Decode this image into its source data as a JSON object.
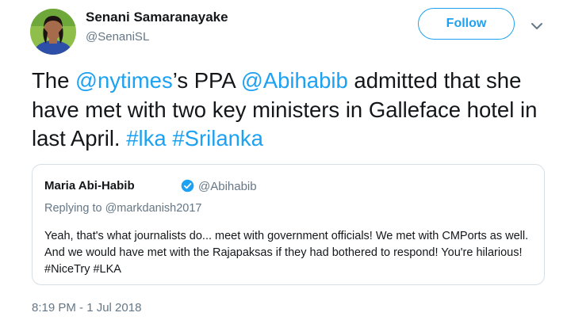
{
  "author": {
    "display_name": "Senani Samaranayake",
    "handle": "@SenaniSL",
    "avatar": "profile-photo"
  },
  "follow_label": "Follow",
  "tweet": {
    "parts": [
      {
        "text": "The ",
        "link": false
      },
      {
        "text": "@nytimes",
        "link": true
      },
      {
        "text": "’s PPA ",
        "link": false
      },
      {
        "text": "@Abihabib",
        "link": true
      },
      {
        "text": " admitted that she have met with two key ministers in Galleface hotel in last April. ",
        "link": false
      },
      {
        "text": "#lka",
        "link": true
      },
      {
        "text": " ",
        "link": false
      },
      {
        "text": "#Srilanka",
        "link": true
      }
    ]
  },
  "quoted_tweet": {
    "author_name": "Maria Abi-Habib",
    "author_handle": "@Abihabib",
    "verified_icon": "verified-badge-icon",
    "replying_to": "Replying to @markdanish2017",
    "text": "Yeah, that's what journalists do... meet with government officials! We met with CMPorts as well. And we would have met with the Rajapaksas if they had bothered to respond! You're hilarious! #NiceTry #LKA"
  },
  "timestamp": "8:19 PM - 1 Jul 2018",
  "colors": {
    "link": "#1da1f2",
    "secondary_text": "#657786",
    "border": "#d8dfe4"
  }
}
